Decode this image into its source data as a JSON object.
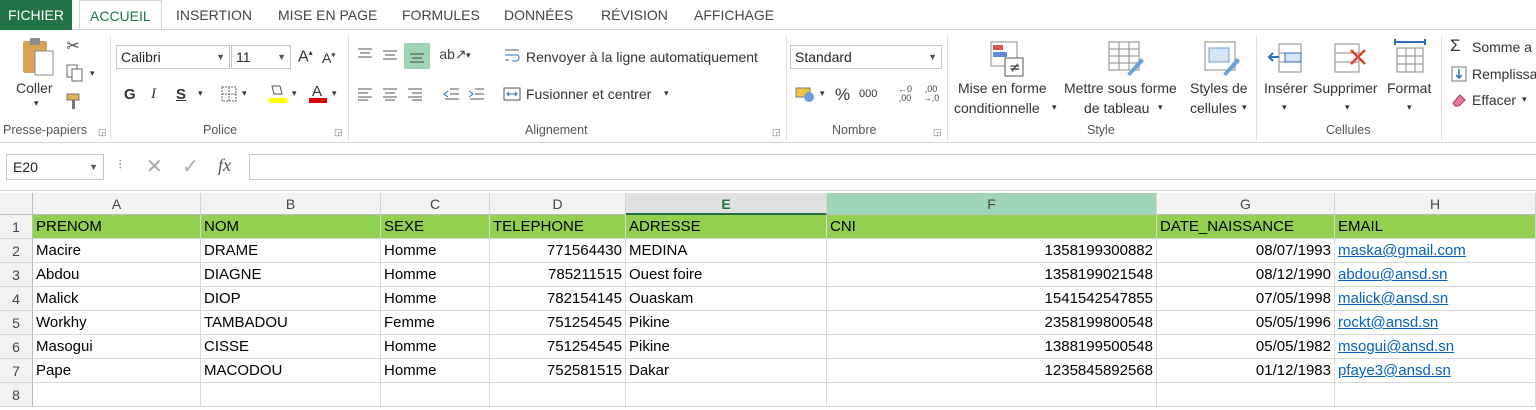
{
  "tabs": [
    "FICHIER",
    "ACCUEIL",
    "INSERTION",
    "MISE EN PAGE",
    "FORMULES",
    "DONNÉES",
    "RÉVISION",
    "AFFICHAGE"
  ],
  "ribbon": {
    "clipboard": {
      "paste": "Coller",
      "label": "Presse-papiers"
    },
    "font": {
      "name": "Calibri",
      "size": "11",
      "bold": "G",
      "italic": "I",
      "underline": "S",
      "label": "Police"
    },
    "alignment": {
      "wrap": "Renvoyer à la ligne automatiquement",
      "merge": "Fusionner et centrer",
      "label": "Alignement"
    },
    "number": {
      "format": "Standard",
      "percent": "%",
      "thousands": "000",
      "label": "Nombre"
    },
    "styles": {
      "conditional_1": "Mise en forme",
      "conditional_2": "conditionnelle",
      "table_1": "Mettre sous forme",
      "table_2": "de tableau",
      "cell_1": "Styles de",
      "cell_2": "cellules",
      "label": "Style"
    },
    "cells": {
      "insert": "Insérer",
      "delete": "Supprimer",
      "format": "Format",
      "label": "Cellules"
    },
    "editing": {
      "sum": "Somme a",
      "fill": "Remplissa",
      "clear": "Effacer"
    }
  },
  "formula_bar": {
    "name_box": "E20",
    "fx": "fx",
    "value": ""
  },
  "columns": [
    "A",
    "B",
    "C",
    "D",
    "E",
    "F",
    "G",
    "H"
  ],
  "rows": [
    "1",
    "2",
    "3",
    "4",
    "5",
    "6",
    "7",
    "8"
  ],
  "headers": [
    "PRENOM",
    "NOM",
    "SEXE",
    "TELEPHONE",
    "ADRESSE",
    "CNI",
    "DATE_NAISSANCE",
    "EMAIL"
  ],
  "records": [
    [
      "Macire",
      "DRAME",
      "Homme",
      "771564430",
      "MEDINA",
      "1358199300882",
      "08/07/1993",
      "maska@gmail.com"
    ],
    [
      "Abdou",
      "DIAGNE",
      "Homme",
      "785211515",
      "Ouest foire",
      "1358199021548",
      "08/12/1990",
      "abdou@ansd.sn"
    ],
    [
      "Malick",
      "DIOP",
      "Homme",
      "782154145",
      "Ouaskam",
      "1541542547855",
      "07/05/1998",
      "malick@ansd.sn"
    ],
    [
      "Workhy",
      "TAMBADOU",
      "Femme",
      "751254545",
      "Pikine",
      "2358199800548",
      "05/05/1996",
      "rockt@ansd.sn"
    ],
    [
      "Masogui",
      "CISSE",
      "Homme",
      "751254545",
      "Pikine",
      "1388199500548",
      "05/05/1982",
      "msogui@ansd.sn"
    ],
    [
      "Pape",
      "MACODOU",
      "Homme",
      "752581515",
      "Dakar",
      "1235845892568",
      "01/12/1983",
      "pfaye3@ansd.sn"
    ]
  ],
  "colors": {
    "accent": "#217346",
    "header_fill": "#92d050",
    "link": "#0563c1"
  }
}
